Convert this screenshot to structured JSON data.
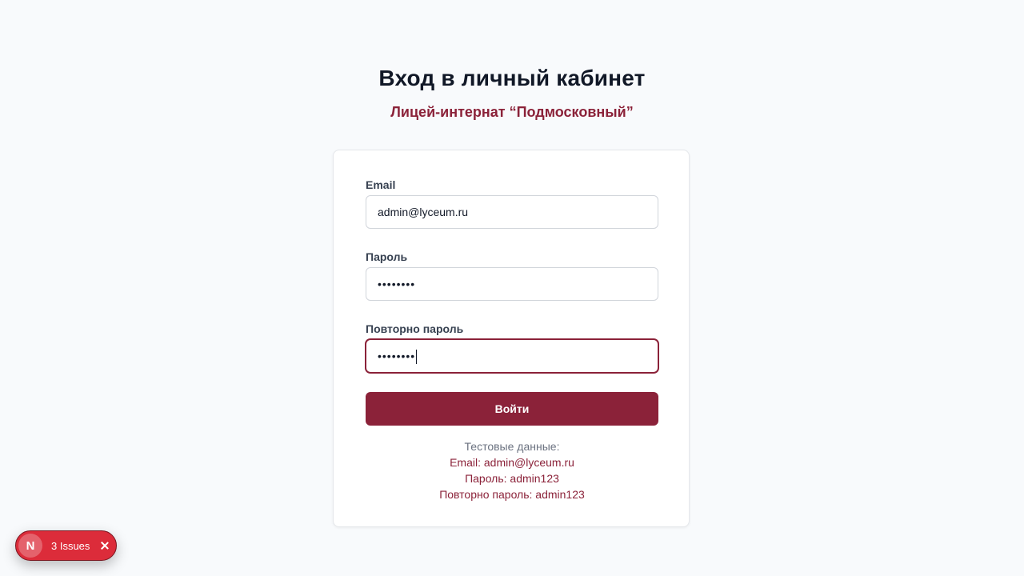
{
  "header": {
    "title": "Вход в личный кабинет",
    "subtitle": "Лицей-интернат “Подмосковный”"
  },
  "form": {
    "email": {
      "label": "Email",
      "value": "admin@lyceum.ru"
    },
    "password": {
      "label": "Пароль",
      "masked_value": "••••••••"
    },
    "password_repeat": {
      "label": "Повторно пароль",
      "masked_value": "••••••••"
    },
    "submit_label": "Войти"
  },
  "test_credentials": {
    "heading": "Тестовые данные:",
    "email_line": "Email: admin@lyceum.ru",
    "password_line": "Пароль: admin123",
    "password_repeat_line": "Повторно пароль: admin123"
  },
  "dev_overlay": {
    "logo_letter": "N",
    "issues_label": "3 Issues",
    "close_icon": "close-icon"
  },
  "colors": {
    "accent": "#8b2239",
    "background": "#f8fafc",
    "issues_badge": "#dc2c3a"
  }
}
